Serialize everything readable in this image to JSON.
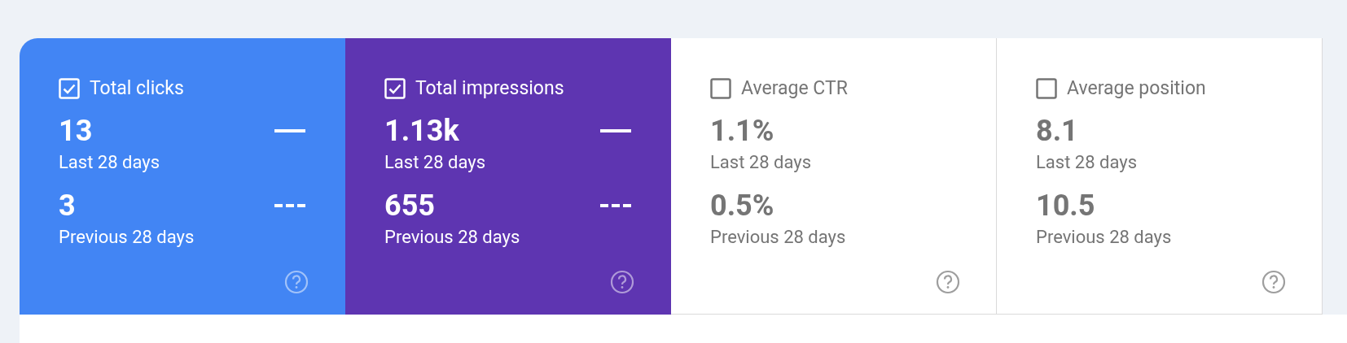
{
  "metrics": [
    {
      "label": "Total clicks",
      "selected": true,
      "color": "#4285f4",
      "current_value": "13",
      "current_period": "Last 28 days",
      "previous_value": "3",
      "previous_period": "Previous 28 days"
    },
    {
      "label": "Total impressions",
      "selected": true,
      "color": "#5e35b1",
      "current_value": "1.13k",
      "current_period": "Last 28 days",
      "previous_value": "655",
      "previous_period": "Previous 28 days"
    },
    {
      "label": "Average CTR",
      "selected": false,
      "current_value": "1.1%",
      "current_period": "Last 28 days",
      "previous_value": "0.5%",
      "previous_period": "Previous 28 days"
    },
    {
      "label": "Average position",
      "selected": false,
      "current_value": "8.1",
      "current_period": "Last 28 days",
      "previous_value": "10.5",
      "previous_period": "Previous 28 days"
    }
  ]
}
